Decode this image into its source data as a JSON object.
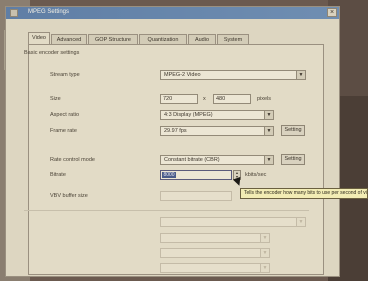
{
  "window": {
    "title": "MPEG Settings",
    "close_glyph": "×"
  },
  "tabs": [
    {
      "label": "Video"
    },
    {
      "label": "Advanced"
    },
    {
      "label": "GOP Structure"
    },
    {
      "label": "Quantization"
    },
    {
      "label": "Audio"
    },
    {
      "label": "System"
    }
  ],
  "section": {
    "title": "Basic encoder settings"
  },
  "fields": {
    "stream_type": {
      "label": "Stream type",
      "value": "MPEG-2 Video"
    },
    "size": {
      "label": "Size",
      "width": "720",
      "height": "480",
      "unit": "pixels",
      "separator": "x"
    },
    "aspect_ratio": {
      "label": "Aspect ratio",
      "value": "4:3 Display (MPEG)"
    },
    "frame_rate": {
      "label": "Frame rate",
      "value": "29.97 fps"
    },
    "rate_control": {
      "label": "Rate control mode",
      "value": "Constant bitrate (CBR)"
    },
    "bitrate": {
      "label": "Bitrate",
      "value": "8000",
      "unit": "kbits/sec"
    },
    "vbv_buffer": {
      "label": "VBV buffer size",
      "value": ""
    }
  },
  "buttons": {
    "setting_1": "Setting",
    "setting_2": "Setting"
  },
  "tooltip": {
    "text": "Tells the encoder how many bits to use per second of video"
  },
  "disabled_rows": [
    {
      "label": "",
      "value": ""
    },
    {
      "label": "",
      "value": ""
    },
    {
      "label": "",
      "value": ""
    },
    {
      "label": "",
      "value": ""
    },
    {
      "label": "",
      "value": ""
    }
  ],
  "icons": {
    "dropdown": "chevron-down-icon",
    "spin": "spinner-icon"
  }
}
